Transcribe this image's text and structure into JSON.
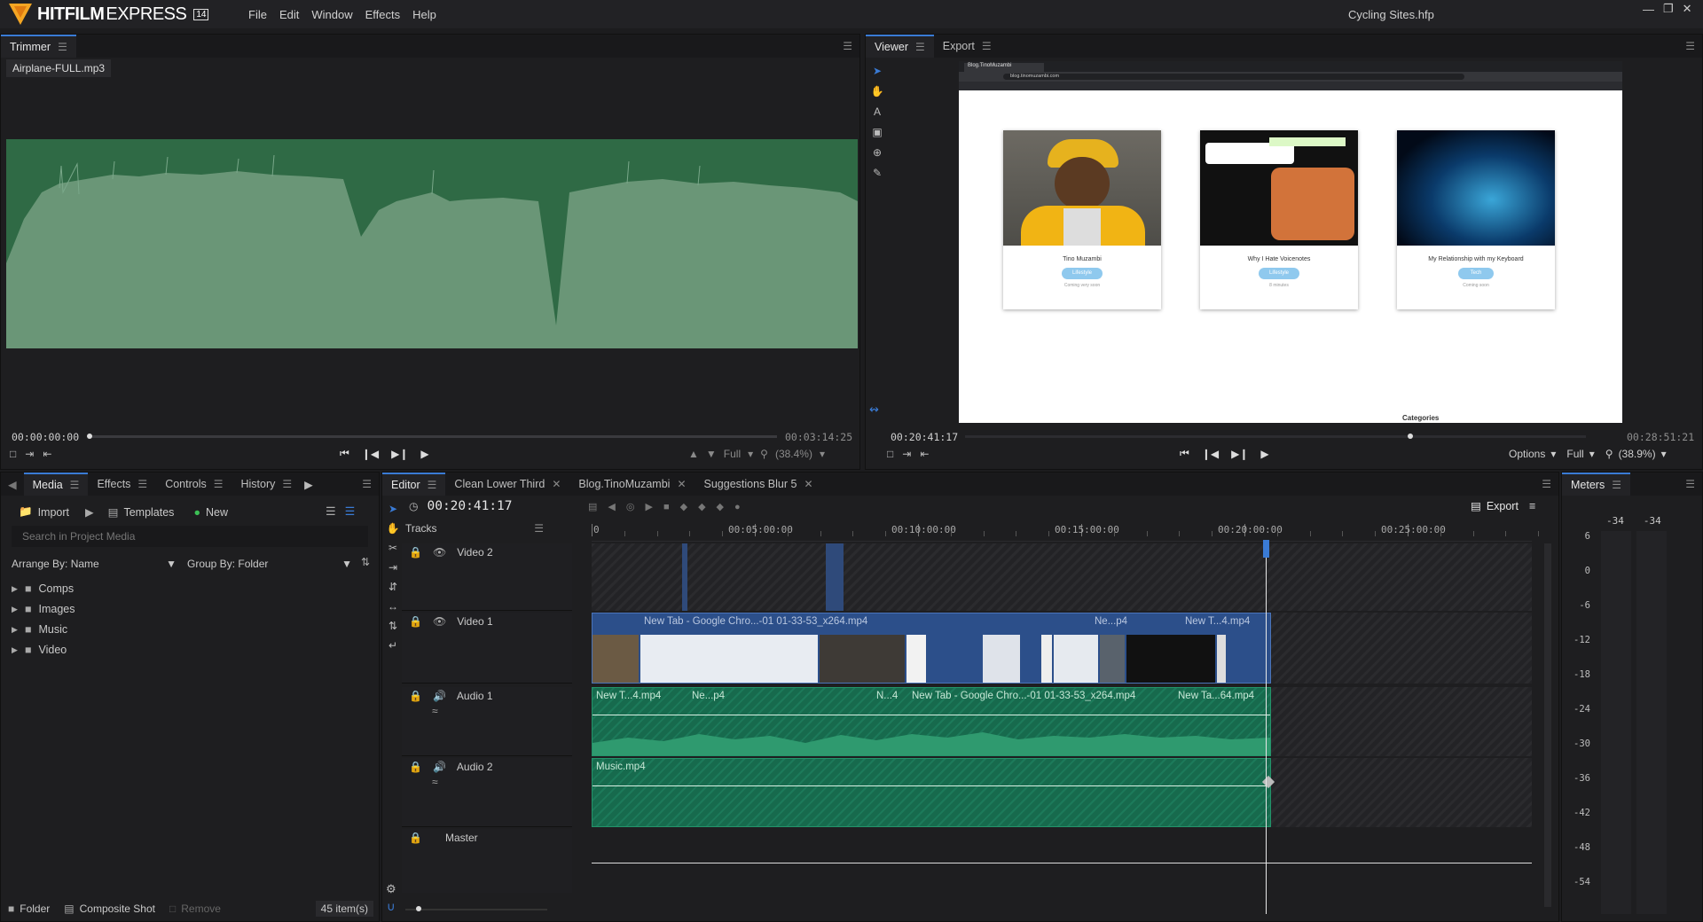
{
  "app": {
    "brand_1": "HITFILM",
    "brand_2": "EXPRESS",
    "version_badge": "14",
    "menu": [
      "File",
      "Edit",
      "Window",
      "Effects",
      "Help"
    ],
    "project_title": "Cycling Sites.hfp",
    "window_controls": [
      "minimize-icon",
      "restore-icon",
      "close-icon"
    ]
  },
  "trimmer": {
    "tab": "Trimmer",
    "file": "Airplane-FULL.mp3",
    "time_in": "00:00:00:00",
    "time_out": "00:03:14:25",
    "quality": "Full",
    "zoom": "(38.4%)",
    "playhead_fraction": 0.0
  },
  "viewer": {
    "tabs": [
      "Viewer",
      "Export"
    ],
    "time_current": "00:20:41:17",
    "time_total": "00:28:51:21",
    "options": "Options",
    "quality": "Full",
    "zoom": "(38.9%)",
    "playhead_fraction": 0.717,
    "browser": {
      "tab_label": "Blog.TinoMuzambi",
      "url": "blog.tinomuzambi.com",
      "cards": [
        {
          "title": "Tino Muzambi",
          "tag": "Lifestyle",
          "meta": "Coming very soon"
        },
        {
          "title": "Why I Hate Voicenotes",
          "tag": "Lifestyle",
          "meta": "8 minutes"
        },
        {
          "title": "My Relationship with my Keyboard",
          "tag": "Tech",
          "meta": "Coming soon"
        }
      ],
      "footer": "Categories"
    }
  },
  "media": {
    "tabs": [
      "Media",
      "Effects",
      "Controls",
      "History"
    ],
    "import": "Import",
    "templates": "Templates",
    "new": "New",
    "search_placeholder": "Search in Project Media",
    "arrange": "Arrange By: Name",
    "group": "Group By: Folder",
    "folders": [
      "Comps",
      "Images",
      "Music",
      "Video"
    ],
    "footer_folder": "Folder",
    "footer_composite": "Composite Shot",
    "footer_remove": "Remove",
    "count": "45 item(s)"
  },
  "editor": {
    "tabs": [
      "Editor",
      "Clean Lower Third",
      "Blog.TinoMuzambi",
      "Suggestions Blur 5"
    ],
    "timecode": "00:20:41:17",
    "export": "Export",
    "tracks_label": "Tracks",
    "ruler": [
      "0",
      "00:05:00:00",
      "00:10:00:00",
      "00:15:00:00",
      "00:20:00:00",
      "00:25:00:00"
    ],
    "playhead_fraction": 0.717,
    "tracks": [
      {
        "name": "Video 2",
        "type": "video"
      },
      {
        "name": "Video 1",
        "type": "video"
      },
      {
        "name": "Audio 1",
        "type": "audio"
      },
      {
        "name": "Audio 2",
        "type": "audio"
      },
      {
        "name": "Master",
        "type": "master"
      }
    ],
    "video1_clips": [
      "New Tab - Google Chro...-01 01-33-53_x264.mp4",
      "Ne...p4",
      "New T...4.mp4"
    ],
    "audio1_clips": [
      "New T...4.mp4",
      "Ne...p4",
      "N...4",
      "New Tab - Google Chro...-01 01-33-53_x264.mp4",
      "New Ta...64.mp4"
    ],
    "audio2_clip": "Music.mp4"
  },
  "meters": {
    "tab": "Meters",
    "channel_values": [
      "-34",
      "-34"
    ],
    "scale": [
      "6",
      "0",
      "-6",
      "-12",
      "-18",
      "-24",
      "-30",
      "-36",
      "-42",
      "-48",
      "-54"
    ]
  },
  "colors": {
    "accent": "#3a7bd5",
    "audio_wave": "#2f7d55",
    "audio_clip": "#1b7a57",
    "video_clip": "#2c4f8a",
    "logo": "#f5a623"
  }
}
